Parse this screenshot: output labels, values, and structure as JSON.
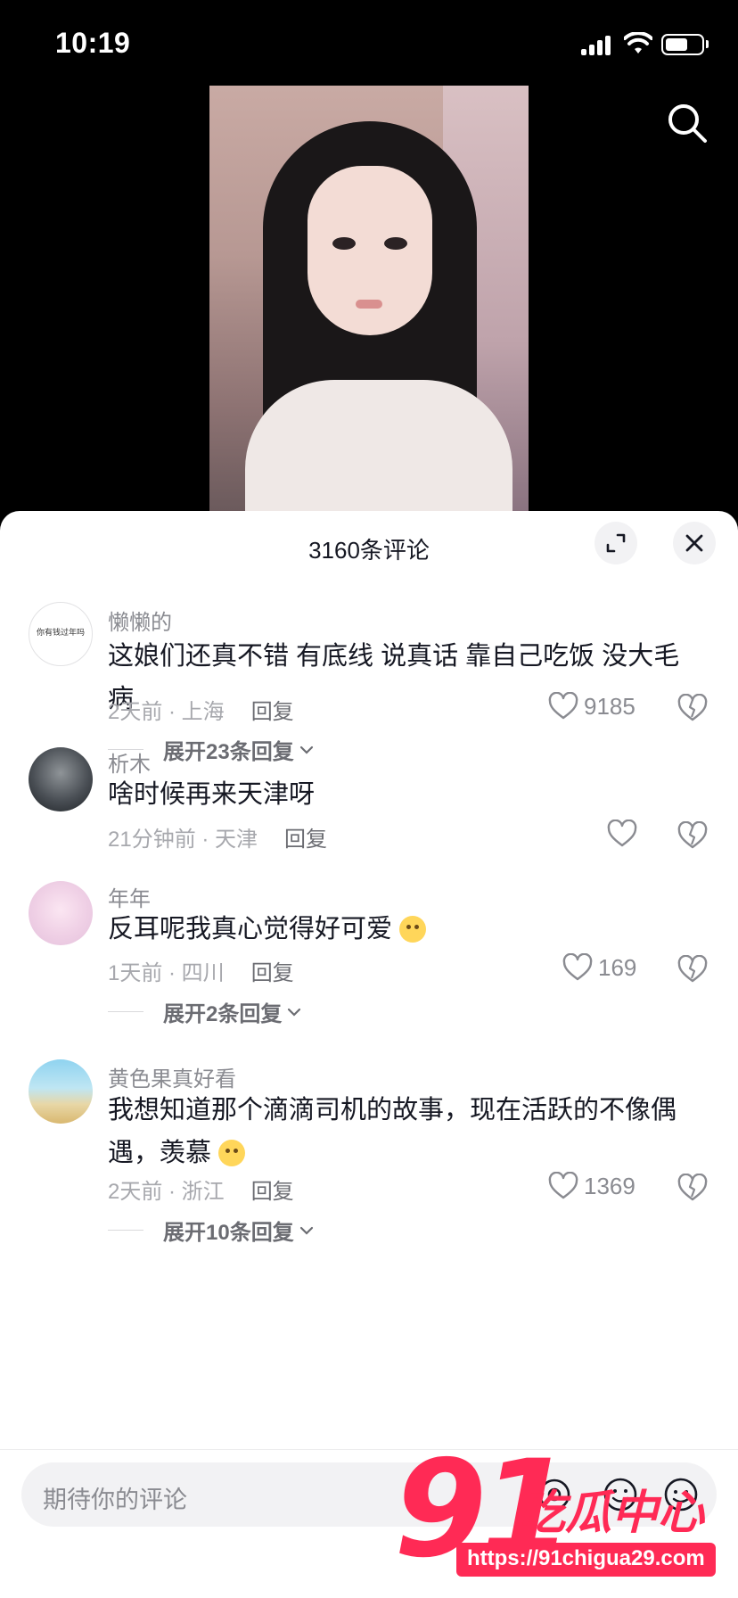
{
  "status_bar": {
    "time": "10:19"
  },
  "sheet": {
    "title": "3160条评论"
  },
  "comments": [
    {
      "username": "懒懒的",
      "avatar_text": "你有钱过年吗",
      "content": "这娘们还真不错 有底线 说真话 靠自己吃饭 没大毛病",
      "meta": "2天前 · 上海",
      "reply_label": "回复",
      "likes": "9185",
      "expand": "展开23条回复"
    },
    {
      "username": "析木",
      "content": "啥时候再来天津呀",
      "meta": "21分钟前 · 天津",
      "reply_label": "回复",
      "likes": ""
    },
    {
      "username": "年年",
      "content": "反耳呢我真心觉得好可爱",
      "meta": "1天前 · 四川",
      "reply_label": "回复",
      "likes": "169",
      "expand": "展开2条回复"
    },
    {
      "username": "黄色果真好看",
      "content": "我想知道那个滴滴司机的故事，现在活跃的不像偶遇，羡慕",
      "meta": "2天前 · 浙江",
      "reply_label": "回复",
      "likes": "1369",
      "expand": "展开10条回复"
    }
  ],
  "input": {
    "placeholder": "期待你的评论"
  },
  "watermark": {
    "number": "91",
    "text": "吃瓜中心",
    "url": "https://91chigua29.com"
  },
  "icons": {
    "search": "search-icon",
    "expand": "expand-icon",
    "close": "close-icon",
    "like": "heart-icon",
    "dislike": "broken-heart-icon",
    "at": "at-icon",
    "emoji": "emoji-icon"
  }
}
